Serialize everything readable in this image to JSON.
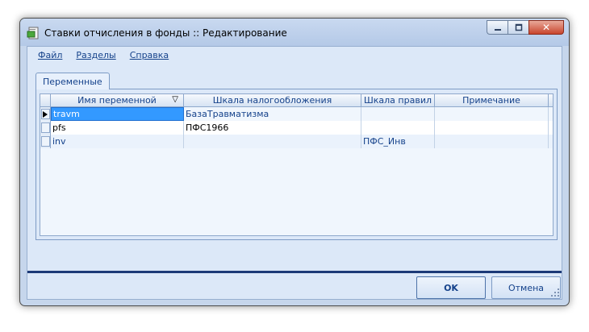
{
  "window": {
    "title": "Ставки отчисления в фонды :: Редактирование",
    "icon": "app-icon"
  },
  "caption_buttons": {
    "minimize_icon": "minimize-icon",
    "maximize_icon": "maximize-icon",
    "close_icon": "close-icon",
    "close_glyph": "✕"
  },
  "menu": {
    "items": [
      "Файл",
      "Разделы",
      "Справка"
    ]
  },
  "tabs": [
    {
      "label": "Переменные",
      "active": true
    }
  ],
  "grid": {
    "columns": [
      "Имя переменной",
      "Шкала налогообложения",
      "Шкала правил",
      "Примечание"
    ],
    "sort_icon": "▽",
    "rows": [
      {
        "name": "travm",
        "tax_scale": "БазаТравматизма",
        "rule_scale": "",
        "note": "",
        "current": true
      },
      {
        "name": "pfs",
        "tax_scale": "ПФС1966",
        "rule_scale": "",
        "note": "",
        "current": false
      },
      {
        "name": "inv",
        "tax_scale": "",
        "rule_scale": "ПФС_Инв",
        "note": "",
        "current": false
      }
    ]
  },
  "buttons": {
    "ok": "OK",
    "cancel": "Отмена"
  },
  "colors": {
    "selection": "#3399ff",
    "accent": "#15428b",
    "separator": "#1c3a78",
    "window_bg": "#c6d6ec"
  }
}
